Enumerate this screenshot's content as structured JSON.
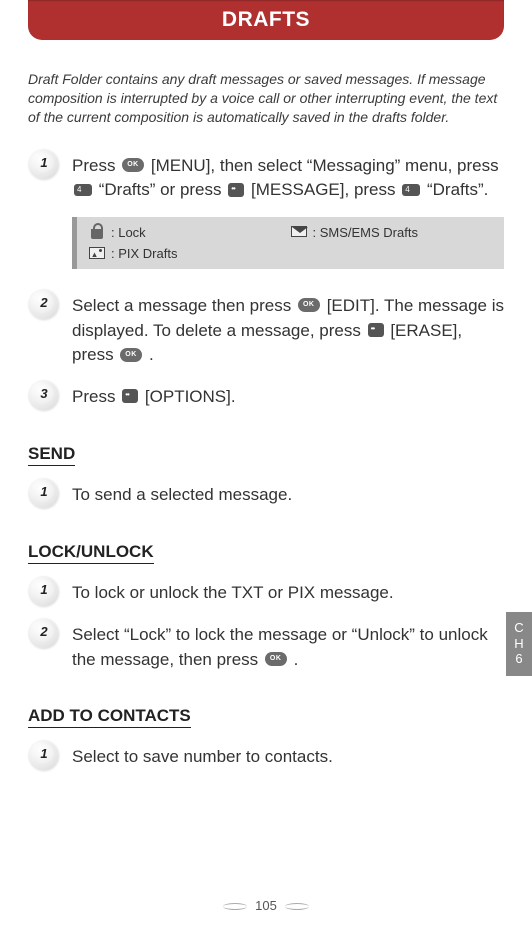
{
  "header": {
    "title": "DRAFTS"
  },
  "intro": "Draft Folder contains any draft messages or saved messages. If message composition is interrupted by a voice call or other interrupting event, the text of the current composition is automatically saved in the drafts folder.",
  "steps_main": [
    {
      "num": "1",
      "parts": [
        "Press ",
        "__OK__",
        " [MENU], then select “Messaging” menu, press ",
        "__4__",
        " “Drafts” or press ",
        "__SK__",
        " [MESSAGE], press ",
        "__4__",
        " “Drafts”."
      ]
    },
    {
      "num": "2",
      "parts": [
        "Select a message then press ",
        "__OK__",
        " [EDIT]. The message is displayed. To delete a message, press ",
        "__SK__",
        " [ERASE], press ",
        "__OK__",
        " ."
      ]
    },
    {
      "num": "3",
      "parts": [
        "Press ",
        "__SK__",
        " [OPTIONS]."
      ]
    }
  ],
  "legend": {
    "lock": ": Lock",
    "sms": ": SMS/EMS Drafts",
    "pix": ": PIX Drafts"
  },
  "send": {
    "title": "SEND",
    "steps": [
      {
        "num": "1",
        "parts": [
          "To send a selected message."
        ]
      }
    ]
  },
  "lock": {
    "title": "LOCK/UNLOCK",
    "steps": [
      {
        "num": "1",
        "parts": [
          "To lock or unlock the TXT or PIX message."
        ]
      },
      {
        "num": "2",
        "parts": [
          "Select “Lock” to lock the message or “Unlock” to unlock the message, then press ",
          "__OK__",
          " ."
        ]
      }
    ]
  },
  "add": {
    "title": "ADD TO CONTACTS",
    "steps": [
      {
        "num": "1",
        "parts": [
          "Select to save number to contacts."
        ]
      }
    ]
  },
  "side": {
    "c": "C",
    "h": "H",
    "n": "6"
  },
  "page": "105"
}
